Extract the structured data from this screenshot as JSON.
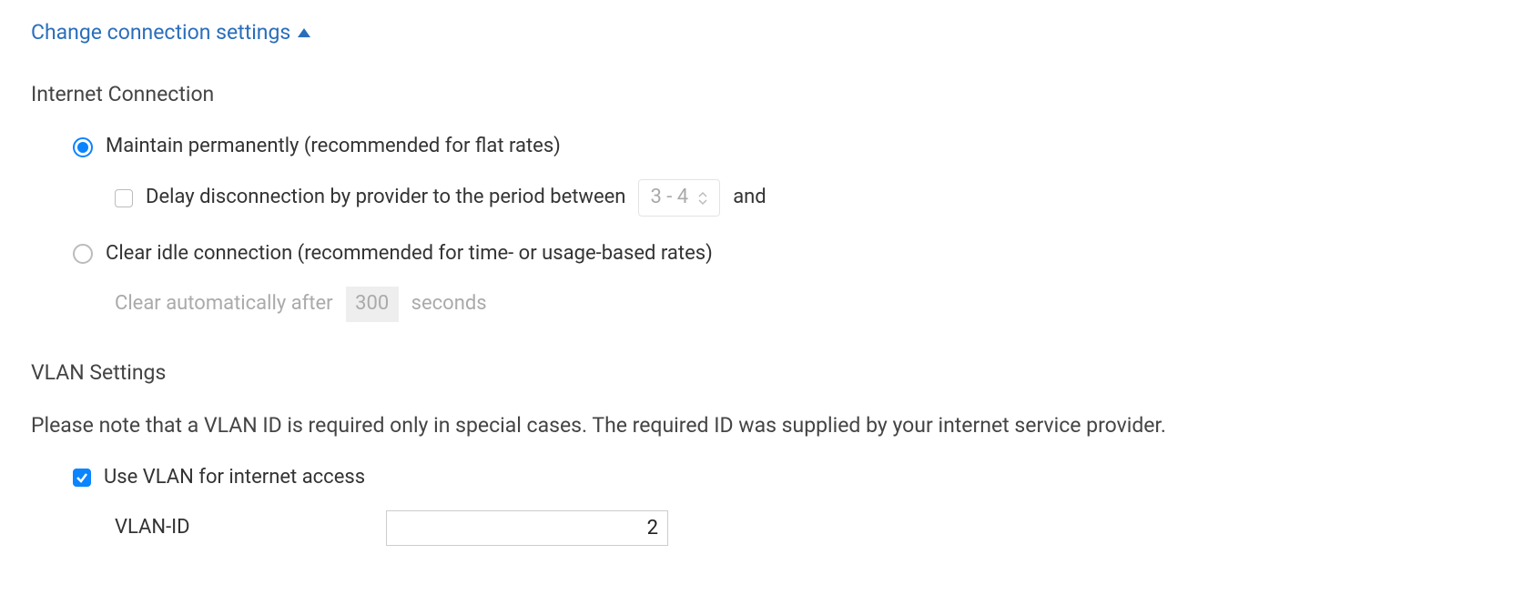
{
  "header": {
    "link": "Change connection settings"
  },
  "internet": {
    "title": "Internet Connection",
    "option_maintain": "Maintain permanently (recommended for flat rates)",
    "delay_label_before": "Delay disconnection by provider to the period between",
    "delay_value": "3 - 4",
    "delay_label_after": "and",
    "option_clear": "Clear idle connection (recommended for time- or usage-based rates)",
    "clear_auto_before": "Clear automatically after",
    "clear_auto_value": "300",
    "clear_auto_after": "seconds"
  },
  "vlan": {
    "title": "VLAN Settings",
    "note": "Please note that a VLAN ID is required only in special cases. The required ID was supplied by your internet service provider.",
    "use_label": "Use VLAN for internet access",
    "id_label": "VLAN-ID",
    "id_value": "2"
  }
}
